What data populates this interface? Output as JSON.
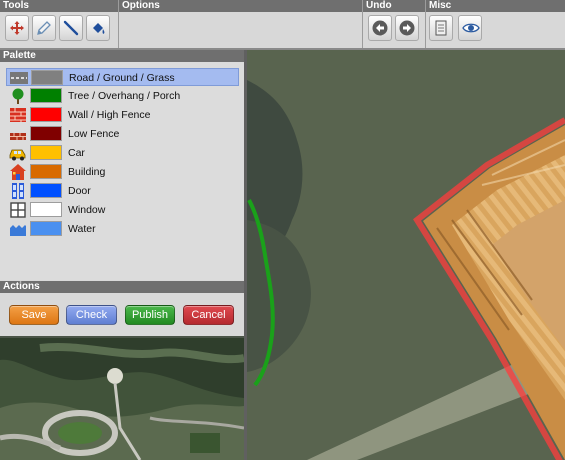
{
  "toolbar": {
    "sections": {
      "tools": "Tools",
      "options": "Options",
      "undo": "Undo",
      "misc": "Misc"
    },
    "buttons": [
      {
        "icon": "move-arrows-icon"
      },
      {
        "icon": "pencil-icon"
      },
      {
        "icon": "line-icon"
      },
      {
        "icon": "paint-bucket-icon"
      },
      {
        "icon": "undo-arrow-icon"
      },
      {
        "icon": "redo-arrow-icon"
      },
      {
        "icon": "document-icon"
      },
      {
        "icon": "eye-icon"
      }
    ]
  },
  "palette": {
    "title": "Palette",
    "items": [
      {
        "label": "Road / Ground / Grass",
        "color": "#808080",
        "icon": "road-icon",
        "selected": true
      },
      {
        "label": "Tree / Overhang / Porch",
        "color": "#008000",
        "icon": "tree-icon",
        "selected": false
      },
      {
        "label": "Wall / High Fence",
        "color": "#ff0000",
        "icon": "brick-wall-icon",
        "selected": false
      },
      {
        "label": "Low Fence",
        "color": "#800000",
        "icon": "low-fence-icon",
        "selected": false
      },
      {
        "label": "Car",
        "color": "#ffc000",
        "icon": "car-icon",
        "selected": false
      },
      {
        "label": "Building",
        "color": "#d86a00",
        "icon": "house-icon",
        "selected": false
      },
      {
        "label": "Door",
        "color": "#0050ff",
        "icon": "door-icon",
        "selected": false
      },
      {
        "label": "Window",
        "color": "#ffffff",
        "icon": "window-icon",
        "selected": false
      },
      {
        "label": "Water",
        "color": "#4a90f0",
        "icon": "water-icon",
        "selected": false
      }
    ]
  },
  "actions": {
    "title": "Actions",
    "buttons": [
      {
        "label": "Save",
        "color": "#e8821e"
      },
      {
        "label": "Check",
        "color": "#6a87d8"
      },
      {
        "label": "Publish",
        "color": "#2f9e2f"
      },
      {
        "label": "Cancel",
        "color": "#c8323a"
      }
    ]
  }
}
